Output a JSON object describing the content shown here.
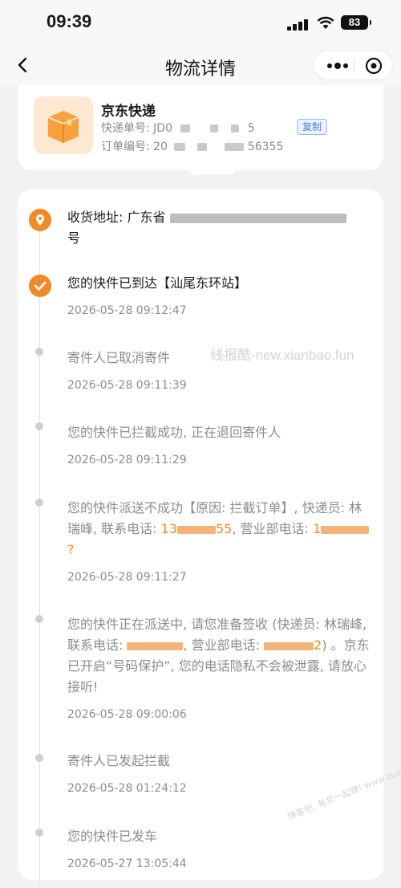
{
  "status_bar": {
    "time": "09:39",
    "battery": "83"
  },
  "nav": {
    "title": "物流详情"
  },
  "package": {
    "carrier": "京东快递",
    "tracking_label": "快递单号: ",
    "tracking_prefix": "JD0",
    "tracking_suffix": "5",
    "copy_label": "复制",
    "order_label": "订单编号: ",
    "order_prefix": "20",
    "order_suffix": "56355"
  },
  "address": {
    "label": "收货地址: ",
    "text_start": "广东省",
    "text_end": "号"
  },
  "events": [
    {
      "text": "您的快件已到达【汕尾东环站】",
      "time": "2026-05-28 09:12:47"
    },
    {
      "text": "寄件人已取消寄件",
      "time": "2026-05-28 09:11:39"
    },
    {
      "text": "您的快件已拦截成功, 正在退回寄件人",
      "time": "2026-05-28 09:11:29"
    },
    {
      "text_a": "您的快件派送不成功【原因: 拦截订单】, 快递员: 林瑞峰, 联系电话: ",
      "phone_a": "13",
      "phone_b": "55",
      "text_b": ", 营业部电话: ",
      "phone_c": "1",
      "phone_d": "?",
      "time": "2026-05-28 09:11:27"
    },
    {
      "text_a": "您的快件正在派送中, 请您准备签收 (快递员: 林瑞峰, 联系电话: ",
      "text_b": ", 营业部电话: ",
      "phone_c": "2",
      "text_c": ") 。京东已开启“号码保护”, 您的电话隐私不会被泄露, 请放心接听!",
      "time": "2026-05-28 09:00:06"
    },
    {
      "text": "寄件人已发起拦截",
      "time": "2026-05-28 01:24:12"
    },
    {
      "text": "您的快件已发车",
      "time": "2026-05-27 13:05:44"
    }
  ],
  "watermarks": {
    "main": "线报酷-new.xianbao.fun",
    "corner": "赚客吧, 有奖一起赚! www.zuanke8.com"
  },
  "colors": {
    "accent": "#f08b2a",
    "link": "#4f7fd6"
  },
  "icons": [
    "back-arrow-icon",
    "more-dots-icon",
    "close-target-icon",
    "package-box-icon",
    "location-pin-icon",
    "check-icon"
  ]
}
